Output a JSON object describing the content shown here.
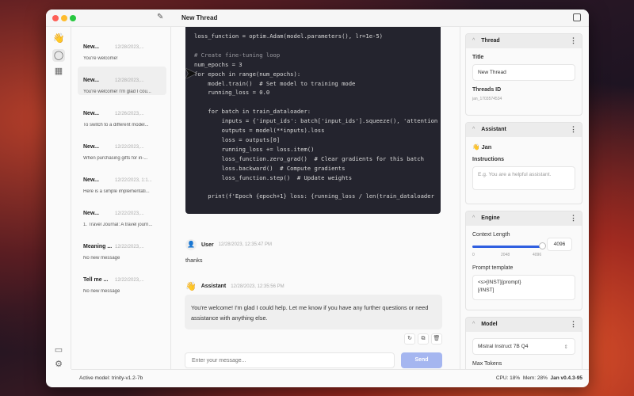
{
  "window": {
    "title": "New Thread"
  },
  "colors": {
    "accent": "#2f5fe0",
    "send": "#a5b6f0",
    "code_bg": "#24242e"
  },
  "rail": {
    "icons": [
      "wave-logo-icon",
      "chat-icon",
      "grid-icon",
      "monitor-icon",
      "gear-icon"
    ]
  },
  "threads": [
    {
      "name": "New...",
      "date": "12/28/2023,...",
      "preview": "You're welcome!"
    },
    {
      "name": "New...",
      "date": "12/28/2023,...",
      "preview": "You're welcome! I'm glad I cou..."
    },
    {
      "name": "New...",
      "date": "12/26/2023,...",
      "preview": "To switch to a different model..."
    },
    {
      "name": "New...",
      "date": "12/22/2023,...",
      "preview": "When purchasing gifts for in-..."
    },
    {
      "name": "New...",
      "date": "12/22/2023, 1:1...",
      "preview": "Here is a simple implementati..."
    },
    {
      "name": "New...",
      "date": "12/22/2023,...",
      "preview": "1. Travel Journal: A travel journ..."
    },
    {
      "name": "Meaning ...",
      "date": "12/22/2023,...",
      "preview": "No new message"
    },
    {
      "name": "Tell me ...",
      "date": "12/22/2023,...",
      "preview": "No new message"
    }
  ],
  "code": [
    "loss_function = optim.Adam(model.parameters(), lr=1e-5)",
    "",
    "# Create fine-tuning loop",
    "num_epochs = 3",
    "for epoch in range(num_epochs):",
    "    model.train()  # Set model to training mode",
    "    running_loss = 0.0",
    "",
    "    for batch in train_dataloader:",
    "        inputs = {'input_ids': batch['input_ids'].squeeze(), 'attention",
    "        outputs = model(**inputs).loss",
    "        loss = outputs[0]",
    "        running_loss += loss.item()",
    "        loss_function.zero_grad()  # Clear gradients for this batch",
    "        loss.backward()  # Compute gradients",
    "        loss_function.step()  # Update weights",
    "",
    "    print(f'Epoch {epoch+1} loss: {running_loss / len(train_dataloader"
  ],
  "messages": {
    "user": {
      "name": "User",
      "time": "12/28/2023, 12:35:47 PM",
      "text": "thanks"
    },
    "assistant": {
      "name": "Assistant",
      "time": "12/28/2023, 12:35:56 PM",
      "text": "You're welcome! I'm glad I could help. Let me know if you have any further questions or need assistance with anything else."
    }
  },
  "composer": {
    "placeholder": "Enter your message...",
    "send": "Send"
  },
  "panel": {
    "thread": {
      "title": "Thread",
      "title_label": "Title",
      "title_value": "New Thread",
      "id_label": "Threads ID",
      "id_value": "jan_1703574534"
    },
    "assistant": {
      "title": "Assistant",
      "name": "Jan",
      "instructions_label": "Instructions",
      "instructions_placeholder": "E.g. You are a helpful assistant."
    },
    "engine": {
      "title": "Engine",
      "context_label": "Context Length",
      "context_value": "4096",
      "context_fraction": 1.0,
      "ticks": [
        "0",
        "2048",
        "4096"
      ],
      "prompt_label": "Prompt template",
      "prompt_value": "<s>[INST]{prompt}\n[/INST]"
    },
    "model": {
      "title": "Model",
      "selected": "Mistral Instruct 7B Q4",
      "max_tokens_label": "Max Tokens"
    }
  },
  "status": {
    "active_model": "Active model: trinity-v1.2-7b",
    "cpu": "CPU: 18%",
    "mem": "Mem: 28%",
    "version": "Jan v0.4.3-95"
  }
}
